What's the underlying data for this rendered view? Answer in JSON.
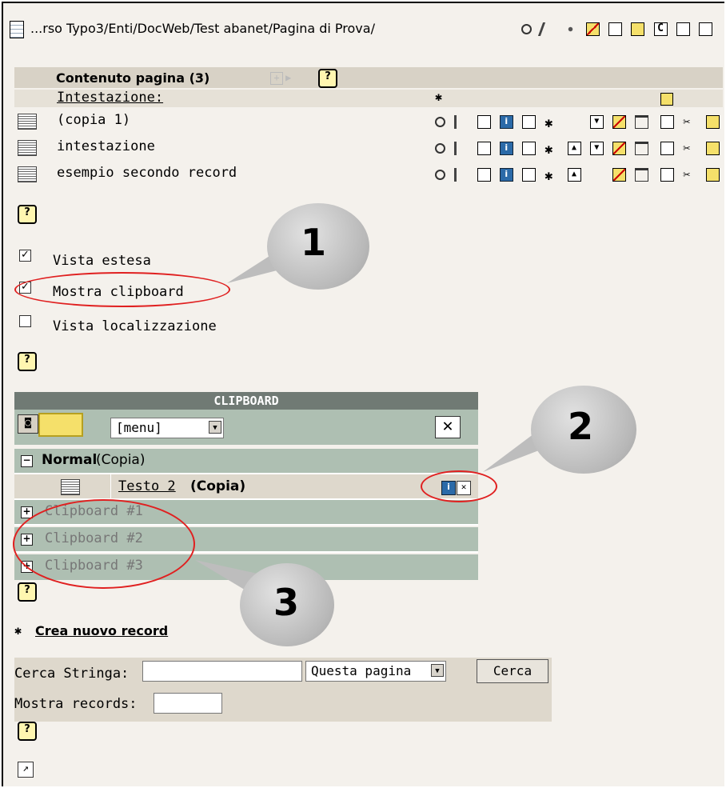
{
  "breadcrumb": "...rso Typo3/Enti/DocWeb/Test abanet/Pagina di Prova/",
  "content": {
    "title": "Contenuto pagina (3)",
    "column_header": "Intestazione:",
    "rows": [
      {
        "label": "(copia 1)"
      },
      {
        "label": "intestazione"
      },
      {
        "label": "esempio secondo record"
      }
    ]
  },
  "options": {
    "extended_view": {
      "label": "Vista estesa",
      "checked": true
    },
    "show_clipboard": {
      "label": "Mostra clipboard",
      "checked": true
    },
    "localization_view": {
      "label": "Vista localizzazione",
      "checked": false
    }
  },
  "clipboard": {
    "title": "CLIPBOARD",
    "menu_value": "[menu]",
    "normal_label": "Normal",
    "normal_suffix": "(Copia)",
    "item_title": "Testo 2",
    "item_suffix": "(Copia)",
    "pads": [
      "Clipboard #1",
      "Clipboard #2",
      "Clipboard #3"
    ]
  },
  "create_record": "Crea nuovo record",
  "search": {
    "label": "Cerca Stringa:",
    "value": "",
    "scope": "Questa pagina",
    "button": "Cerca",
    "records_label": "Mostra records:",
    "records_value": ""
  },
  "callouts": [
    "1",
    "2",
    "3"
  ],
  "colors": {
    "clipboard_bg": "#aebfb2",
    "annotation": "#e02020",
    "page_bg": "#f4f1ec"
  }
}
